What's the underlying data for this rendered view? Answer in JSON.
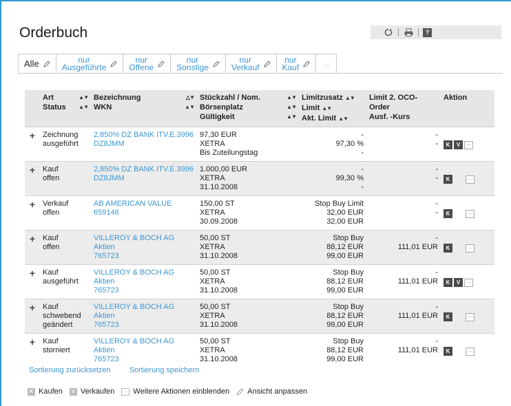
{
  "page": {
    "title": "Orderbuch"
  },
  "tabs": [
    {
      "l1": "Alle",
      "l2": ""
    },
    {
      "l1": "nur",
      "l2": "Ausgeführte"
    },
    {
      "l1": "nur",
      "l2": "Offene"
    },
    {
      "l1": "nur",
      "l2": "Sonstige"
    },
    {
      "l1": "nur",
      "l2": "Verkauf"
    },
    {
      "l1": "nur",
      "l2": "Kauf"
    },
    {
      "l1": "...",
      "l2": ""
    }
  ],
  "table": {
    "headers": {
      "art": "Art",
      "status": "Status",
      "bezeichnung": "Bezeichnung",
      "wkn": "WKN",
      "stueck": "Stückzahl / Nom.",
      "boerse": "Börsenplatz",
      "gueltig": "Gültigkeit",
      "limitzusatz": "Limitzusatz",
      "limit": "Limit",
      "akt_limit": "Akt. Limit",
      "limit2": "Limit 2. OCO-Order",
      "ausf": "Ausf. -Kurs",
      "aktion": "Aktion"
    },
    "rows": [
      {
        "art": "Zeichnung",
        "status": [
          "ausgeführt"
        ],
        "name": "2,850% DZ BANK ITV.E.3996",
        "wkn": "DZ8JMM",
        "menge": "97,30 EUR",
        "platz": "XETRA",
        "gueltig": "Bis Zuteilungstag",
        "zusatz": "-",
        "limit": "97,30 %",
        "akt": "-",
        "l2": "-",
        "kurs": "-",
        "k": true,
        "v": true
      },
      {
        "art": "Kauf",
        "status": [
          "offen"
        ],
        "name": "2,850% DZ BANK ITV.E.3996",
        "wkn": "DZ8JMM",
        "menge": "1.000,00 EUR",
        "platz": "XETRA",
        "gueltig": "31.10.2008",
        "zusatz": "-",
        "limit": "99,30 %",
        "akt": "-",
        "l2": "-",
        "kurs": "-",
        "k": true,
        "v": false
      },
      {
        "art": "Verkauf",
        "status": [
          "offen"
        ],
        "name": "AB AMERICAN VALUE",
        "wkn": "659146",
        "menge": "150,00 ST",
        "platz": "XETRA",
        "gueltig": "30.09.2008",
        "zusatz": "Stop Buy Limit",
        "limit": "32,00 EUR",
        "akt": "32,00 EUR",
        "l2": "-",
        "kurs": "-",
        "k": true,
        "v": false
      },
      {
        "art": "Kauf",
        "status": [
          "offen"
        ],
        "name": "VILLEROY & BOCH AG Aktien",
        "wkn": "765723",
        "menge": "50,00 ST",
        "platz": "XETRA",
        "gueltig": "31.10.2008",
        "zusatz": "Stop Buy",
        "limit": "88,12 EUR",
        "akt": "99,00 EUR",
        "l2": "-",
        "kurs": "111,01 EUR",
        "k": true,
        "v": false
      },
      {
        "art": "Kauf",
        "status": [
          "ausgeführt"
        ],
        "name": "VILLEROY & BOCH AG Aktien",
        "wkn": "765723",
        "menge": "50,00 ST",
        "platz": "XETRA",
        "gueltig": "31.10.2008",
        "zusatz": "Stop Buy",
        "limit": "88,12 EUR",
        "akt": "99,00 EUR",
        "l2": "-",
        "kurs": "111,01 EUR",
        "k": true,
        "v": true
      },
      {
        "art": "Kauf",
        "status": [
          "schwebend",
          "geändert"
        ],
        "name": "VILLEROY & BOCH AG Aktien",
        "wkn": "765723",
        "menge": "50,00 ST",
        "platz": "XETRA",
        "gueltig": "31.10.2008",
        "zusatz": "Stop Buy",
        "limit": "88,12 EUR",
        "akt": "99,00 EUR",
        "l2": "-",
        "kurs": "111,01 EUR",
        "k": true,
        "v": false
      },
      {
        "art": "Kauf",
        "status": [
          "storniert"
        ],
        "name": "VILLEROY & BOCH AG Aktien",
        "wkn": "765723",
        "menge": "50,00 ST",
        "platz": "XETRA",
        "gueltig": "31.10.2008",
        "zusatz": "Stop Buy",
        "limit": "88,12 EUR",
        "akt": "99,00 EUR",
        "l2": "-",
        "kurs": "111,01 EUR",
        "k": true,
        "v": false
      }
    ]
  },
  "actions": {
    "k": "K",
    "v": "V",
    "more": "···"
  },
  "links": {
    "reset": "Sortierung zurücksetzen",
    "save": "Sortierung speichern"
  },
  "legend": {
    "buy": "Kaufen",
    "sell": "Verkaufen",
    "more": "Weitere Aktionen einblenden",
    "view": "Ansicht anpassen"
  },
  "icons": {
    "refresh": "refresh-icon",
    "print": "print-icon",
    "help": "help-icon",
    "pencil": "pencil-icon",
    "expand": "plus-icon"
  },
  "colors": {
    "link": "#3a96d2",
    "frame": "#2e9ad0",
    "header_bg": "#e6e6e6",
    "alt_row": "#ececec"
  }
}
